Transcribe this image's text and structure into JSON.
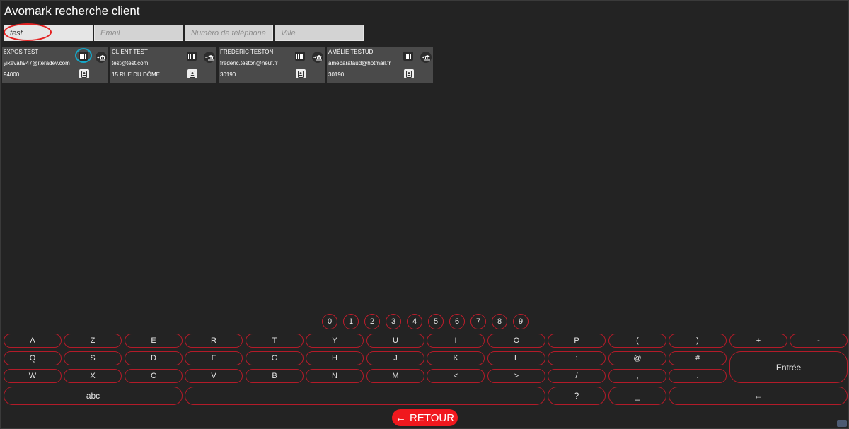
{
  "app": {
    "title": "Avomark recherche client"
  },
  "search": {
    "name_value": "test",
    "email_placeholder": "Email",
    "phone_placeholder": "Numéro de téléphone",
    "city_placeholder": "Ville"
  },
  "clients": [
    {
      "name": "6XPOS   TEST",
      "email": "yikevah947@iteradev.com",
      "line3": "94000"
    },
    {
      "name": "CLIENT   TEST",
      "email": "test@test.com",
      "line3": "15 RUE DU DÔME"
    },
    {
      "name": "FREDERIC   TESTON",
      "email": "frederic.teston@neuf.fr",
      "line3": "30190"
    },
    {
      "name": "AMÉLIE   TESTUD",
      "email": "amebarataud@hotmail.fr",
      "line3": "30190"
    }
  ],
  "keyboard": {
    "digits": [
      "0",
      "1",
      "2",
      "3",
      "4",
      "5",
      "6",
      "7",
      "8",
      "9"
    ],
    "row1": [
      "A",
      "Z",
      "E",
      "R",
      "T",
      "Y",
      "U",
      "I",
      "O",
      "P",
      "(",
      ")",
      "+",
      "-"
    ],
    "row2": [
      "Q",
      "S",
      "D",
      "F",
      "G",
      "H",
      "J",
      "K",
      "L",
      ":",
      "@",
      "#"
    ],
    "row3": [
      "W",
      "X",
      "C",
      "V",
      "B",
      "N",
      "M",
      "<",
      ">",
      "/",
      ",",
      "."
    ],
    "enter_label": "Entrée",
    "abc_label": "abc",
    "space_label": "",
    "question_label": "?",
    "underscore_label": "_",
    "backspace_label": "←"
  },
  "footer": {
    "back_arrow": "←",
    "back_label": "RETOUR"
  },
  "colors": {
    "accent": "#f0181e",
    "key_border": "#b31b29",
    "card_bg": "#4a4a4a",
    "highlight_blue": "#15a7c8"
  }
}
